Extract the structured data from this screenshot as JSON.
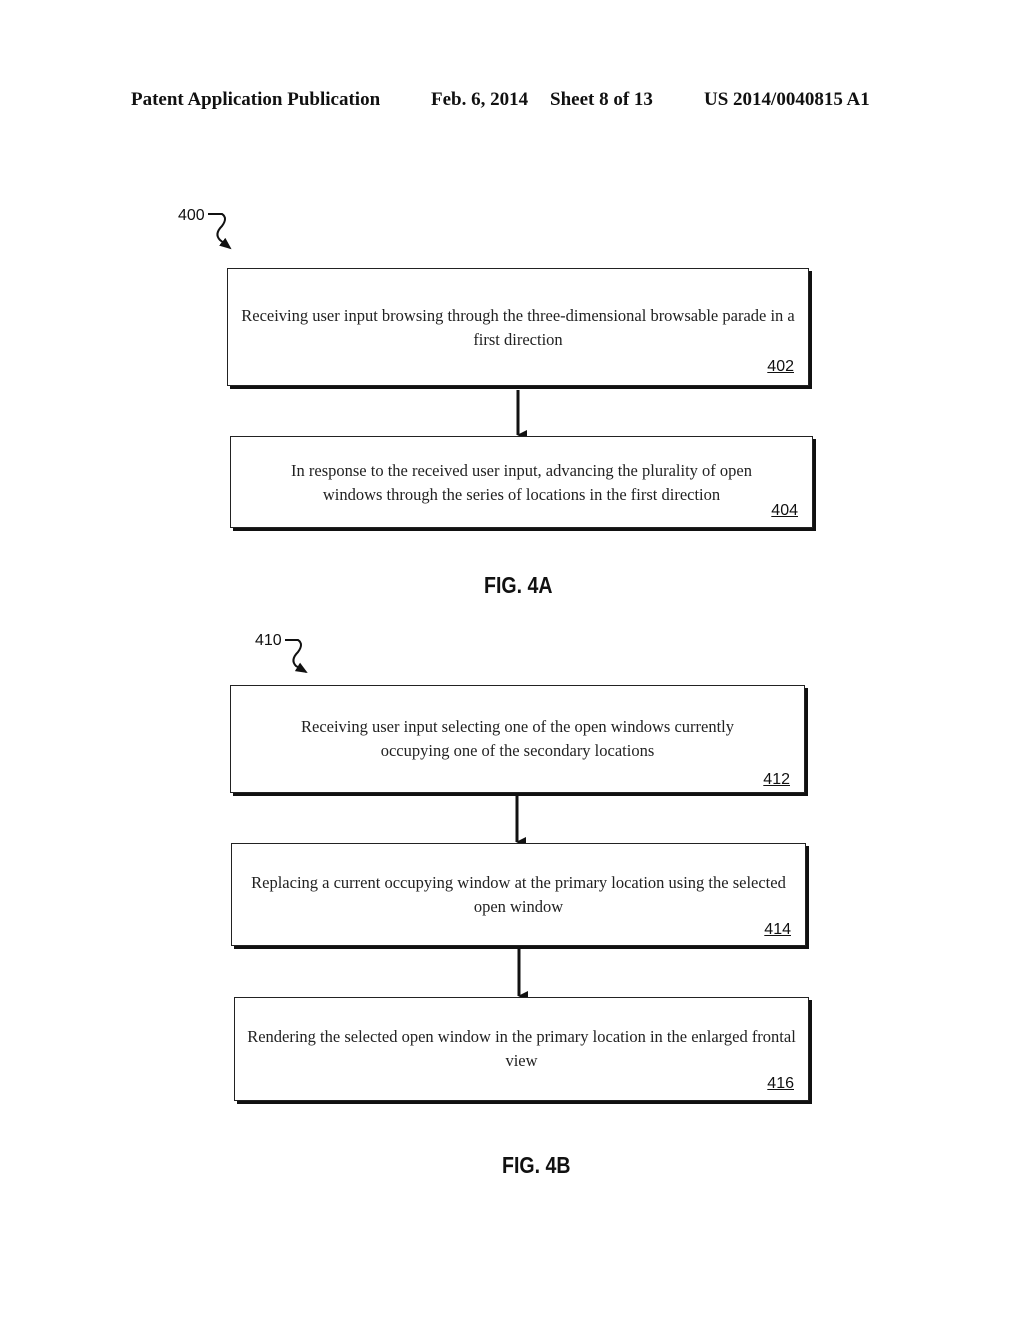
{
  "header": {
    "left": "Patent Application Publication",
    "date": "Feb. 6, 2014",
    "sheet": "Sheet 8 of 13",
    "pub_number": "US 2014/0040815 A1"
  },
  "fig4a": {
    "ref": "400",
    "caption": "FIG. 4A",
    "steps": [
      {
        "text": "Receiving user input browsing through the three-dimensional browsable parade in a first direction",
        "num": "402"
      },
      {
        "text": "In response to the received user input, advancing the plurality of open windows through the series of locations in the first direction",
        "num": "404"
      }
    ]
  },
  "fig4b": {
    "ref": "410",
    "caption": "FIG. 4B",
    "steps": [
      {
        "text": "Receiving user input selecting one of the open windows currently occupying one of the secondary locations",
        "num": "412"
      },
      {
        "text": "Replacing a current occupying window at the primary location using the selected open window",
        "num": "414"
      },
      {
        "text": "Rendering the selected open window in the primary location in the enlarged frontal view",
        "num": "416"
      }
    ]
  }
}
